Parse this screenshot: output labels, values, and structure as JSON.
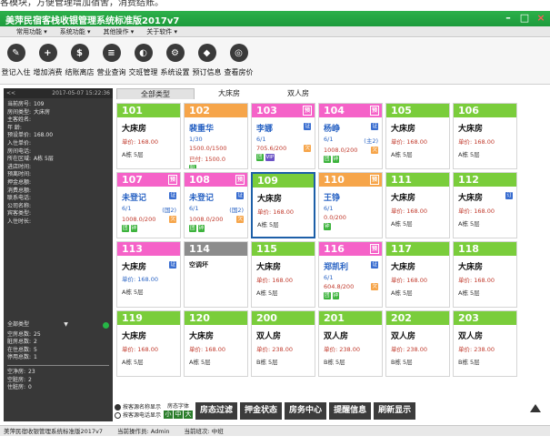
{
  "crop_text": "客模块，方便管理增加宿舍，消费结账。",
  "window": {
    "title": "美萍民宿客栈收银管理系统标准版2017v7",
    "buttons": [
      "–",
      "□",
      "×"
    ]
  },
  "menu": [
    "常用功能 ▾",
    "系统功能 ▾",
    "其他操作 ▾",
    "关于软件 ▾"
  ],
  "toolbar": [
    {
      "label": "登记入住",
      "icon": "edit-icon",
      "glyph": "✎"
    },
    {
      "label": "增加消费",
      "icon": "add-consume-icon",
      "glyph": "+"
    },
    {
      "label": "结账离店",
      "icon": "checkout-icon",
      "glyph": "$"
    },
    {
      "label": "营业查询",
      "icon": "query-icon",
      "glyph": "≡"
    },
    {
      "label": "交班管理",
      "icon": "shift-icon",
      "glyph": "◐"
    },
    {
      "label": "系统设置",
      "icon": "gear-icon",
      "glyph": "⚙"
    },
    {
      "label": "预订信息",
      "icon": "booking-icon",
      "glyph": "◆"
    },
    {
      "label": "查看房价",
      "icon": "price-icon",
      "glyph": "◎"
    }
  ],
  "left_panel": {
    "nav": "<<",
    "datetime": "2017-05-07 15:22:36",
    "fields": [
      {
        "k": "当前房号:",
        "v": "109"
      },
      {
        "k": "房间类型:",
        "v": "大床房"
      },
      {
        "k": "主客姓名:",
        "v": ""
      },
      {
        "k": "年    龄:",
        "v": ""
      },
      {
        "k": "预设单价:",
        "v": "168.00"
      },
      {
        "k": "入住单价:",
        "v": ""
      },
      {
        "k": "房间电话:",
        "v": ""
      },
      {
        "k": "所在区域:",
        "v": "A栋 5层"
      },
      {
        "k": "进店时间:",
        "v": ""
      },
      {
        "k": "预离时间:",
        "v": ""
      },
      {
        "k": "押金总额:",
        "v": ""
      },
      {
        "k": "消费总额:",
        "v": ""
      },
      {
        "k": "联系电话:",
        "v": ""
      },
      {
        "k": "公司名称:",
        "v": ""
      },
      {
        "k": "宾客类型:",
        "v": ""
      },
      {
        "k": "入住时长:",
        "v": ""
      }
    ],
    "category": "全部类型",
    "stats": [
      {
        "k": "空房总数:",
        "v": "25"
      },
      {
        "k": "脏房总数:",
        "v": "2"
      },
      {
        "k": "在住总数:",
        "v": "5"
      },
      {
        "k": "停用总数:",
        "v": "1"
      }
    ],
    "stats2": [
      {
        "k": "空净房:",
        "v": "23"
      },
      {
        "k": "空脏房:",
        "v": "2"
      },
      {
        "k": "住脏房:",
        "v": "0"
      }
    ]
  },
  "tabs": [
    "全部类型",
    "大床房",
    "双人房"
  ],
  "rooms": [
    {
      "no": "101",
      "color": "green",
      "type": "vacant",
      "name": "大床房",
      "price": "单价: 168.00",
      "bld": "A栋 5层"
    },
    {
      "no": "102",
      "color": "orange",
      "type": "occupied",
      "name": "裴重华",
      "l1": "1/30",
      "l2": "1500.0/1500",
      "l3": "已付: 1500.0",
      "badges": [
        {
          "t": "阳",
          "c": "green"
        }
      ]
    },
    {
      "no": "103",
      "color": "pink",
      "tag": "预",
      "type": "occupied",
      "name": "李娜",
      "side": "证",
      "l1": "6/1",
      "l2": "705.6/200",
      "l2b": "欠",
      "badges": [
        {
          "t": "团",
          "c": "green"
        },
        {
          "t": "VIP",
          "c": "purple"
        }
      ]
    },
    {
      "no": "104",
      "color": "pink",
      "tag": "预",
      "type": "occupied",
      "name": "杨峥",
      "side": "证",
      "l1": "6/1",
      "l1b": "(主2)",
      "l2": "1008.0/200",
      "l2b": "欠",
      "badges": [
        {
          "t": "团",
          "c": "green"
        },
        {
          "t": "钟",
          "c": "green"
        }
      ]
    },
    {
      "no": "105",
      "color": "green",
      "type": "vacant",
      "name": "大床房",
      "price": "单价: 168.00",
      "bld": "A栋 5层"
    },
    {
      "no": "106",
      "color": "green",
      "type": "vacant",
      "name": "大床房",
      "price": "单价: 168.00",
      "bld": "A栋 5层"
    },
    {
      "no": "107",
      "color": "pink",
      "tag": "预",
      "type": "occupied",
      "name": "未登记",
      "side": "证",
      "l1": "6/1",
      "l1b": "(国2)",
      "l2": "1008.0/200",
      "l2b": "欠",
      "badges": [
        {
          "t": "团",
          "c": "green"
        },
        {
          "t": "钟",
          "c": "green"
        }
      ]
    },
    {
      "no": "108",
      "color": "pink",
      "tag": "预",
      "type": "occupied",
      "name": "未登记",
      "side": "证",
      "l1": "6/1",
      "l1b": "(国2)",
      "l2": "1008.0/200",
      "l2b": "欠",
      "badges": [
        {
          "t": "团",
          "c": "green"
        },
        {
          "t": "钟",
          "c": "green"
        }
      ]
    },
    {
      "no": "109",
      "color": "green",
      "type": "vacant",
      "selected": true,
      "name": "大床房",
      "price": "单价: 168.00",
      "bld": "A栋 5层"
    },
    {
      "no": "110",
      "color": "orange",
      "tag": "预",
      "type": "occupied",
      "name": "王铮",
      "l1": "6/1",
      "l2": "0.0/200",
      "badges": [
        {
          "t": "钟",
          "c": "green"
        }
      ]
    },
    {
      "no": "111",
      "color": "green",
      "type": "vacant",
      "name": "大床房",
      "price": "单价: 168.00",
      "bld": "A栋 5层"
    },
    {
      "no": "112",
      "color": "green",
      "type": "vacant",
      "name": "大床房",
      "side": "订",
      "price": "单价: 168.00",
      "bld": "A栋 5层"
    },
    {
      "no": "113",
      "color": "pink",
      "type": "vacant",
      "name": "大床房",
      "side": "证",
      "price2": "单价: 168.00",
      "bld": "A栋 5层"
    },
    {
      "no": "114",
      "color": "gray",
      "type": "broken",
      "name": "空调坏"
    },
    {
      "no": "115",
      "color": "green",
      "type": "vacant",
      "name": "大床房",
      "price": "单价: 168.00",
      "bld": "A栋 5层"
    },
    {
      "no": "116",
      "color": "pink",
      "tag": "预",
      "type": "occupied",
      "name": "郑凯利",
      "side": "证",
      "l1": "6/1",
      "l2": "604.8/200",
      "l2b": "欠",
      "badges": [
        {
          "t": "团",
          "c": "green"
        },
        {
          "t": "钟",
          "c": "green"
        }
      ]
    },
    {
      "no": "117",
      "color": "green",
      "type": "vacant",
      "name": "大床房",
      "price": "单价: 168.00",
      "bld": "A栋 5层"
    },
    {
      "no": "118",
      "color": "green",
      "type": "vacant",
      "name": "大床房",
      "price": "单价: 168.00",
      "bld": "A栋 5层"
    },
    {
      "no": "119",
      "color": "green",
      "type": "vacant",
      "name": "大床房",
      "price": "单价: 168.00",
      "bld": "A栋 5层"
    },
    {
      "no": "120",
      "color": "green",
      "type": "vacant",
      "name": "大床房",
      "price": "单价: 168.00",
      "bld": "A栋 5层"
    },
    {
      "no": "200",
      "color": "green",
      "type": "vacant",
      "name": "双人房",
      "price": "单价: 238.00",
      "bld": "B栋 5层"
    },
    {
      "no": "201",
      "color": "green",
      "type": "vacant",
      "name": "双人房",
      "price": "单价: 238.00",
      "bld": "B栋 5层"
    },
    {
      "no": "202",
      "color": "green",
      "type": "vacant",
      "name": "双人房",
      "price": "单价: 238.00",
      "bld": "B栋 5层"
    },
    {
      "no": "203",
      "color": "green",
      "type": "vacant",
      "name": "双人房",
      "price": "单价: 238.00",
      "bld": "B栋 5层"
    }
  ],
  "bottom": {
    "radio1": "按客源名称显示",
    "radio2": "按客源电话显示",
    "font_label": "房态字体",
    "font_btns": [
      "小",
      "中",
      "大"
    ],
    "buttons": [
      "房态过滤",
      "押金状态",
      "房务中心",
      "提醒信息",
      "刷新显示"
    ]
  },
  "status": [
    "美萍民宿收银管理系统标准版2017v7",
    "当前操作员: Admin",
    "当前班次: 中班"
  ]
}
